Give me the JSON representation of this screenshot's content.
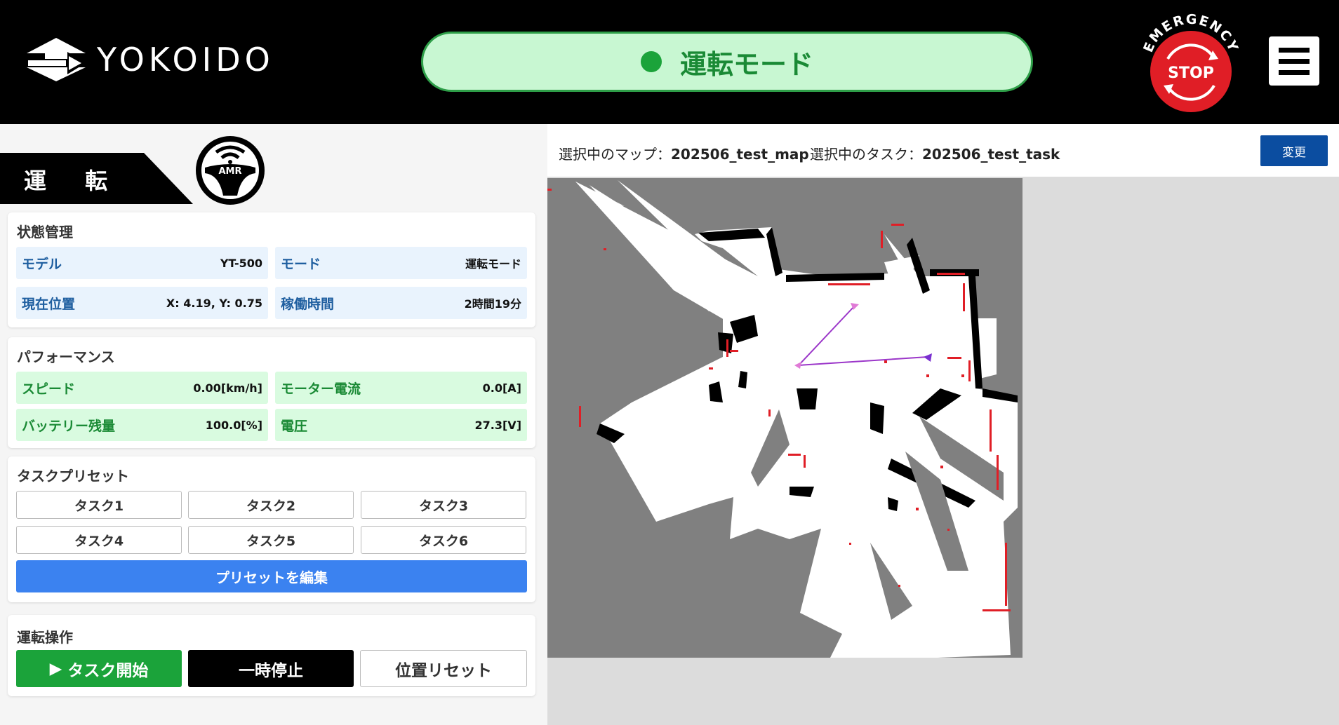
{
  "header": {
    "logo_text": "YOKOIDO",
    "mode_label": "運転モード",
    "estop_top_text": "EMERGENCY",
    "estop_center_text": "STOP"
  },
  "left_panel": {
    "title": "運 転",
    "wheel_label": "AMR",
    "status": {
      "title": "状態管理",
      "model_label": "モデル",
      "model_value": "YT-500",
      "mode_label": "モード",
      "mode_value": "運転モード",
      "position_label": "現在位置",
      "position_value": "X: 4.19, Y: 0.75",
      "uptime_label": "稼働時間",
      "uptime_value": "2時間19分"
    },
    "performance": {
      "title": "パフォーマンス",
      "speed_label": "スピード",
      "speed_value": "0.00[km/h]",
      "current_label": "モーター電流",
      "current_value": "0.0[A]",
      "battery_label": "バッテリー残量",
      "battery_value": "100.0[%]",
      "voltage_label": "電圧",
      "voltage_value": "27.3[V]"
    },
    "presets": {
      "title": "タスクプリセット",
      "tasks": [
        "タスク1",
        "タスク2",
        "タスク3",
        "タスク4",
        "タスク5",
        "タスク6"
      ],
      "edit_label": "プリセットを編集"
    },
    "operation": {
      "title": "運転操作",
      "start_label": "タスク開始",
      "pause_label": "一時停止",
      "reset_label": "位置リセット"
    }
  },
  "right_panel": {
    "map_prefix": "選択中のマップ：",
    "map_name": "202506_test_map",
    "task_prefix": "選択中のタスク：",
    "task_name": "202506_test_task",
    "change_label": "変更"
  },
  "colors": {
    "accent_green": "#1ba33a",
    "pill_bg": "#c8f7d2",
    "estop_red": "#e01e26",
    "primary_blue": "#3b82f0",
    "navy": "#0b4da0"
  }
}
